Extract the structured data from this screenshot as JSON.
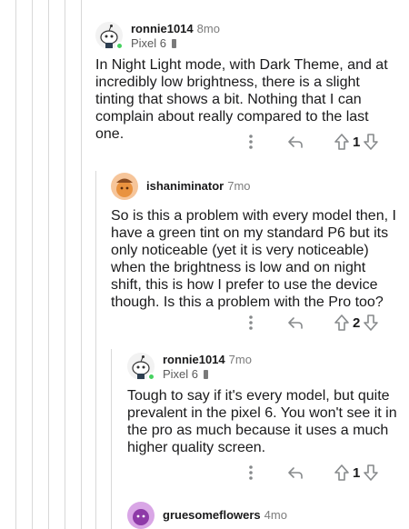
{
  "comments": [
    {
      "username": "ronnie1014",
      "time": "8mo",
      "flair": "Pixel 6",
      "body": "In Night Light mode, with Dark Theme, and at incredibly low brightness, there is a slight tinting that shows a bit. Nothing that I can complain about really compared to the last one.",
      "score": "1",
      "avatar": "snoo-avatar-white"
    },
    {
      "username": "ishaniminator",
      "time": "7mo",
      "flair": "",
      "body": "So is this a problem with every model then, I have a green tint on my standard P6 but its only noticeable (yet it is very noticeable) when the brightness is low and on night shift, this is how I prefer to use the device though. Is this a problem with the Pro too?",
      "score": "2",
      "avatar": "snoo-avatar-orange"
    },
    {
      "username": "ronnie1014",
      "time": "7mo",
      "flair": "Pixel 6",
      "body": "Tough to say if it's every model, but quite prevalent in the pixel 6. You won't see it in the pro as much because it uses a much higher quality screen.",
      "score": "1",
      "avatar": "snoo-avatar-white"
    },
    {
      "username": "gruesomeflowers",
      "time": "4mo",
      "flair": "",
      "body": "",
      "score": "",
      "avatar": "snoo-avatar-purple"
    }
  ],
  "colors": {
    "thread_line": "#d8d8d8",
    "online": "#46d160",
    "icon": "#878a8c"
  }
}
